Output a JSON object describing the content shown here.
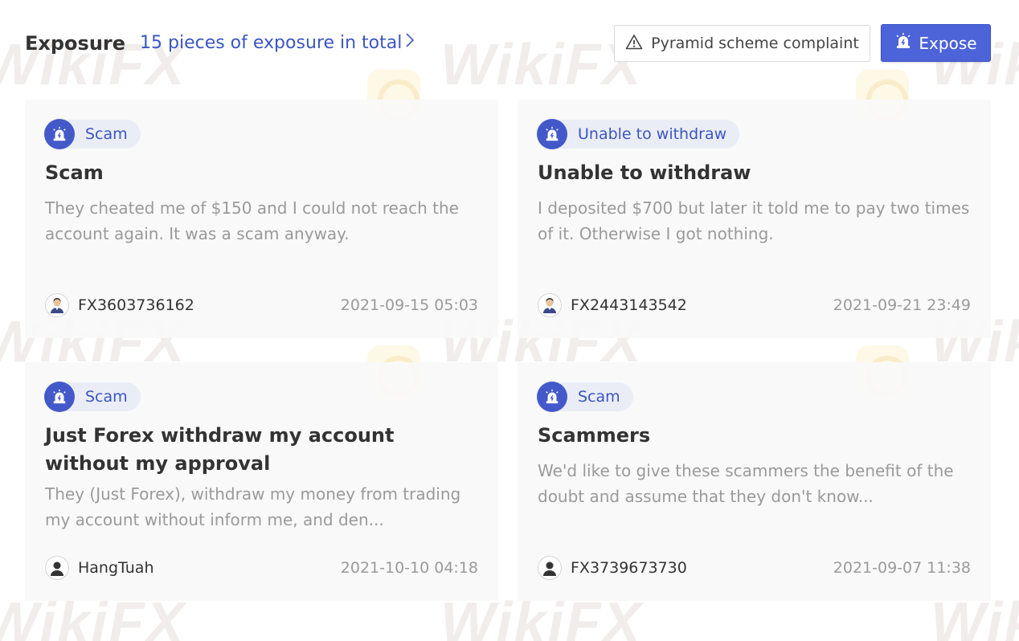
{
  "header": {
    "title": "Exposure",
    "total_link": "15 pieces of exposure in total",
    "complaint_button": "Pyramid scheme complaint",
    "expose_button": "Expose"
  },
  "watermark": {
    "text": "WikiFX"
  },
  "cards": [
    {
      "tag": "Scam",
      "title": "Scam",
      "body": "They cheated me of $150 and I could not reach the account again. It was a scam anyway.",
      "user": "FX3603736162",
      "date": "2021-09-15 05:03"
    },
    {
      "tag": "Unable to withdraw",
      "title": "Unable to withdraw",
      "body": "I deposited $700 but later it told me to pay two times of it. Otherwise I got nothing.",
      "user": "FX2443143542",
      "date": "2021-09-21 23:49"
    },
    {
      "tag": "Scam",
      "title": "Just Forex withdraw my account without my approval",
      "body": "They (Just Forex), withdraw my money from trading my account without inform me, and den...",
      "user": "HangTuah",
      "date": "2021-10-10 04:18"
    },
    {
      "tag": "Scam",
      "title": "Scammers",
      "body": "We'd like to give these scammers the benefit of the doubt and assume that they don't know...",
      "user": "FX3739673730",
      "date": "2021-09-07 11:38"
    }
  ],
  "colors": {
    "accent": "#4d63d8",
    "link": "#3a56c2",
    "card_bg": "#f8f8fa",
    "muted_text": "#9a9a9a"
  }
}
